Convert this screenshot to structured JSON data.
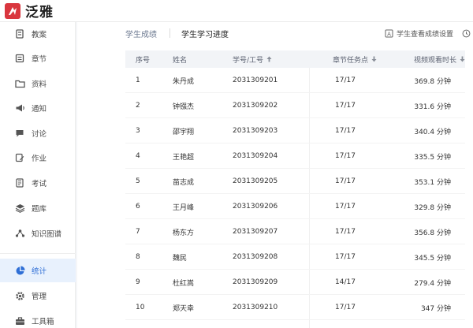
{
  "app": {
    "brand": "泛雅",
    "brand_color": "#d9363e",
    "accent_color": "#2f6fd6"
  },
  "sidebar": {
    "items": [
      {
        "label": "教案",
        "icon": "lesson-plan-icon",
        "active": false
      },
      {
        "label": "章节",
        "icon": "chapter-list-icon",
        "active": false
      },
      {
        "label": "资料",
        "icon": "folder-icon",
        "active": false
      },
      {
        "label": "通知",
        "icon": "megaphone-icon",
        "active": false
      },
      {
        "label": "讨论",
        "icon": "chat-bubble-icon",
        "active": false
      },
      {
        "label": "作业",
        "icon": "homework-edit-icon",
        "active": false
      },
      {
        "label": "考试",
        "icon": "exam-paper-icon",
        "active": false
      },
      {
        "label": "题库",
        "icon": "layers-icon",
        "active": false
      },
      {
        "label": "知识图谱",
        "icon": "knowledge-graph-icon",
        "active": false
      },
      {
        "label": "统计",
        "icon": "pie-chart-icon",
        "active": true
      },
      {
        "label": "管理",
        "icon": "gear-icon",
        "active": false
      },
      {
        "label": "工具箱",
        "icon": "toolbox-icon",
        "active": false
      }
    ]
  },
  "tabs": [
    {
      "label": "学生成绩",
      "active": false
    },
    {
      "label": "学生学习进度",
      "active": true
    }
  ],
  "toolbar": {
    "settings_label": "学生查看成绩设置",
    "settings_icon": "text-doc-icon",
    "history_icon": "clock-icon"
  },
  "table": {
    "columns": [
      {
        "label": "序号",
        "sortable": false
      },
      {
        "label": "姓名",
        "sortable": false
      },
      {
        "label": "学号/工号",
        "sortable": true,
        "sort_dir": "asc"
      },
      {
        "label": "章节任务点",
        "sortable": true,
        "sort_dir": "desc"
      },
      {
        "label": "视频观看时长",
        "sortable": true,
        "sort_dir": "desc"
      }
    ],
    "rows": [
      {
        "index": "1",
        "name": "朱丹成",
        "id": "2031309201",
        "tasks": "17/17",
        "video": "369.8 分钟"
      },
      {
        "index": "2",
        "name": "钟镪杰",
        "id": "2031309202",
        "tasks": "17/17",
        "video": "331.6 分钟"
      },
      {
        "index": "3",
        "name": "邵宇翔",
        "id": "2031309203",
        "tasks": "17/17",
        "video": "340.4 分钟"
      },
      {
        "index": "4",
        "name": "王艳超",
        "id": "2031309204",
        "tasks": "17/17",
        "video": "335.5 分钟"
      },
      {
        "index": "5",
        "name": "苗志成",
        "id": "2031309205",
        "tasks": "17/17",
        "video": "353.1 分钟"
      },
      {
        "index": "6",
        "name": "王月峰",
        "id": "2031309206",
        "tasks": "17/17",
        "video": "329.8 分钟"
      },
      {
        "index": "7",
        "name": "杨东方",
        "id": "2031309207",
        "tasks": "17/17",
        "video": "356.8 分钟"
      },
      {
        "index": "8",
        "name": "魏民",
        "id": "2031309208",
        "tasks": "17/17",
        "video": "345.5 分钟"
      },
      {
        "index": "9",
        "name": "杜红嵩",
        "id": "2031309209",
        "tasks": "14/17",
        "video": "279.4 分钟"
      },
      {
        "index": "10",
        "name": "郑天幸",
        "id": "2031309210",
        "tasks": "17/17",
        "video": "347 分钟"
      }
    ]
  }
}
